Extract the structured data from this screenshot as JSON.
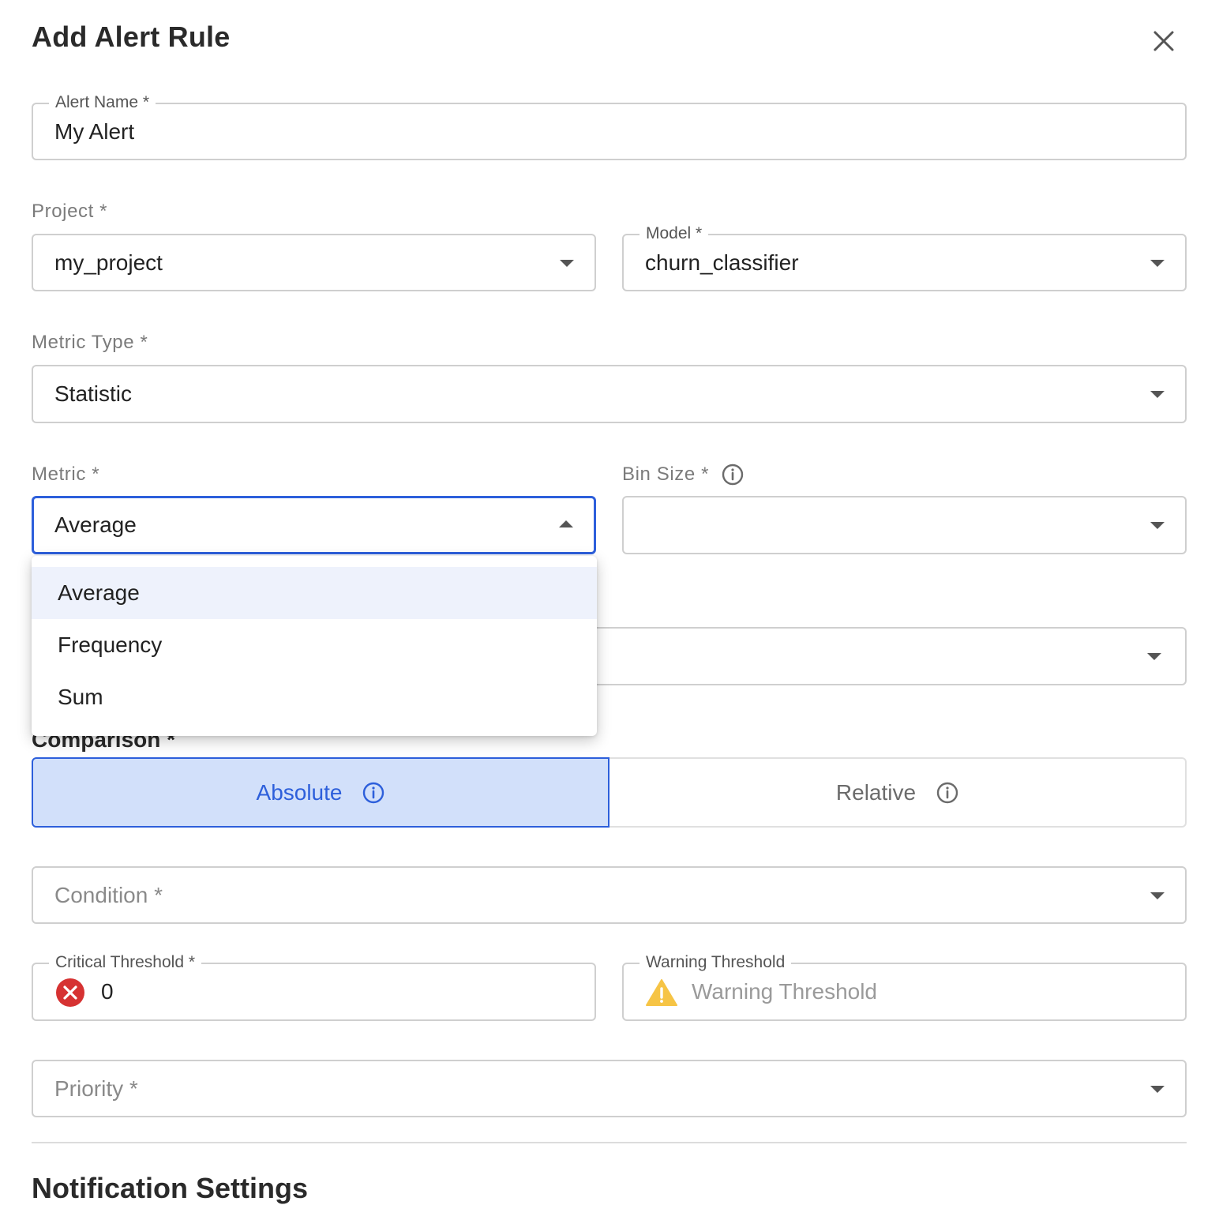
{
  "dialog": {
    "title": "Add Alert Rule"
  },
  "alert_name": {
    "label": "Alert Name *",
    "value": "My Alert"
  },
  "project": {
    "label": "Project *",
    "value": "my_project"
  },
  "model": {
    "label": "Model *",
    "value": "churn_classifier"
  },
  "metric_type": {
    "label": "Metric Type *",
    "value": "Statistic"
  },
  "metric": {
    "label": "Metric *",
    "value": "Average",
    "options": [
      "Average",
      "Frequency",
      "Sum"
    ],
    "selected_option": "Average"
  },
  "bin_size": {
    "label": "Bin Size *",
    "value": ""
  },
  "comparison": {
    "label": "Comparison *",
    "options": [
      "Absolute",
      "Relative"
    ],
    "active": "Absolute"
  },
  "condition": {
    "placeholder": "Condition *"
  },
  "critical_threshold": {
    "label": "Critical Threshold *",
    "value": "0",
    "icon": "error-circle-icon"
  },
  "warning_threshold": {
    "label": "Warning Threshold",
    "placeholder": "Warning Threshold",
    "icon": "warning-triangle-icon"
  },
  "priority": {
    "placeholder": "Priority *"
  },
  "notification": {
    "title": "Notification Settings"
  },
  "colors": {
    "accent": "#2d5fdb",
    "accent_bg": "#d2e0fa",
    "error": "#d63232",
    "warning": "#f6c445"
  }
}
